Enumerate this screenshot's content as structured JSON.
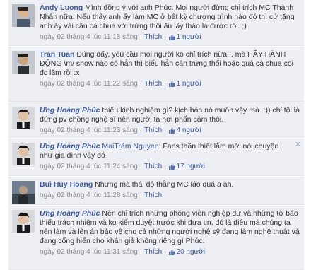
{
  "comments": [
    {
      "author": "Andy Luong",
      "text": "Mình đồng ý với anh Phúc. Mọi người đừng chỉ trích MC Thành Nhân nữa. Nếu thấy anh ấy làm MC ở bất kỳ chương trình nào đó thì cứ tặng anh ấy vài cân cà chua với trứng thối ăn lấy thảo là được rồi. ;)",
      "time": "ngày 02 tháng 4 lúc 11:18 sáng",
      "like_label": "Thích",
      "likes": "1 người"
    },
    {
      "author": "Tran Tuan",
      "text": "Đúng đấy, yêu cầu mọi người ko chỉ trích nữa... mà HÃY HÀNH ĐỘNG \\m/ show nào có hắn thì biểu hắn cân trứng thối hoặc quả cà chua coi đc lắm rồi :x",
      "time": "ngày 02 tháng 4 lúc 11:22 sáng",
      "like_label": "Thích",
      "likes": "1 người"
    },
    {
      "author": "Ưng Hoàng Phúc",
      "text": "thiếu kinh nghiệm gì? kịch bản nó muốn vậy mà. :)) chỉ tội là đứng pv chồng nghệ sĩ nên người ta hơi phẩn cảm thôi.",
      "time": "ngày 02 tháng 4 lúc 11:23 sáng",
      "like_label": "Thích",
      "likes": "4 người"
    },
    {
      "author": "Ưng Hoàng Phúc",
      "mention": "MaiTrâm Nguyen",
      "text": ": Fans thân thiết lắm mới nói chuyện như gia đình vậy đó",
      "time": "ngày 02 tháng 4 lúc 11:24 sáng",
      "like_label": "Thích",
      "likes": "17 người",
      "close": "✕"
    },
    {
      "author": "Bui Huy Hoang",
      "text": "Nhưng mà thái độ thằng MC láo quá a àh.",
      "time": "ngày 02 tháng 4 lúc 11:28 sáng",
      "like_label": "Thích",
      "likes": ""
    },
    {
      "author": "Ưng Hoàng Phúc",
      "text": "Nên chỉ trích những phóng viên nghiệp dư và những tờ báo thiếu trách nhiệm và ko kiểm duyệt trước khi đưa tin, đó là điều mà chúng ta nên làm và lên án bảo vệ cho cả những người nghệ sỹ đang làm nghệ thuật và đang cống hiến cho khán giả không riêng gì Phúc.",
      "time": "ngày 02 tháng 4 lúc 11:31 sáng",
      "like_label": "Thích",
      "likes": "20 người"
    }
  ]
}
